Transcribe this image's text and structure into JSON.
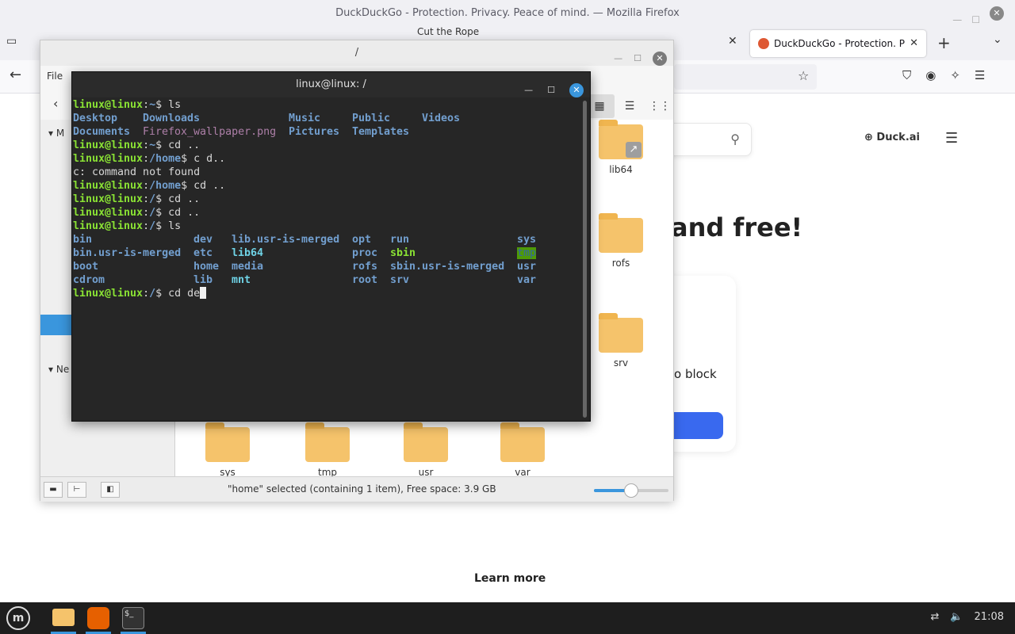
{
  "firefox": {
    "window_title": "DuckDuckGo - Protection. Privacy. Peace of mind. — Mozilla Firefox",
    "active_tab_title": "DuckDuckGo - Protection. P",
    "background_tab_title": "Cut the Rope",
    "page": {
      "duck_ai_label": "Duck.ai",
      "headline": "and free!",
      "card_text": "o block",
      "learn_more": "Learn more"
    }
  },
  "file_manager": {
    "title": "/",
    "menu_file": "File",
    "sidebar_header_1": "M",
    "sidebar_header_2": "Ne",
    "folders": [
      {
        "name": "lib64"
      },
      {
        "name": "rofs"
      },
      {
        "name": "srv"
      },
      {
        "name": "sys"
      },
      {
        "name": "tmp"
      },
      {
        "name": "usr"
      },
      {
        "name": "var"
      }
    ],
    "status_text": "\"home\" selected (containing 1 item), Free space: 3.9 GB",
    "zoom_level": 0.5
  },
  "terminal": {
    "title": "linux@linux: /",
    "prompt_user": "linux@linux",
    "lines": {
      "l1_path": "~",
      "l1_cmd": "ls",
      "home_ls_row1": [
        "Desktop",
        "Downloads",
        "Music",
        "Public",
        "Videos"
      ],
      "home_ls_row2_dir1": "Documents",
      "home_ls_row2_file": "Firefox_wallpaper.png",
      "home_ls_row2_dirs": [
        "Pictures",
        "Templates"
      ],
      "l4_path": "~",
      "l4_cmd": "cd ..",
      "l5_path": "/home",
      "l5_cmd": "c d..",
      "l6_error": "c: command not found",
      "l7_path": "/home",
      "l7_cmd": "cd ..",
      "l8_path": "/",
      "l8_cmd": "cd ..",
      "l9_path": "/",
      "l9_cmd": "cd ..",
      "l10_path": "/",
      "l10_cmd": "ls",
      "last_path": "/",
      "last_cmd": "cd de"
    },
    "root_ls": [
      [
        "bin",
        "dev",
        "lib.usr-is-merged",
        "opt",
        "run",
        "sys"
      ],
      [
        "bin.usr-is-merged",
        "etc",
        "lib64",
        "proc",
        "sbin",
        "tmp"
      ],
      [
        "boot",
        "home",
        "media",
        "rofs",
        "sbin.usr-is-merged",
        "usr"
      ],
      [
        "cdrom",
        "lib",
        "mnt",
        "root",
        "srv",
        "var"
      ]
    ]
  },
  "taskbar": {
    "clock": "21:08"
  },
  "colors": {
    "prompt_green": "#8ae234",
    "dir_blue": "#729fcf",
    "accent_blue": "#3a96dd",
    "ddg_button": "#3969ef"
  }
}
